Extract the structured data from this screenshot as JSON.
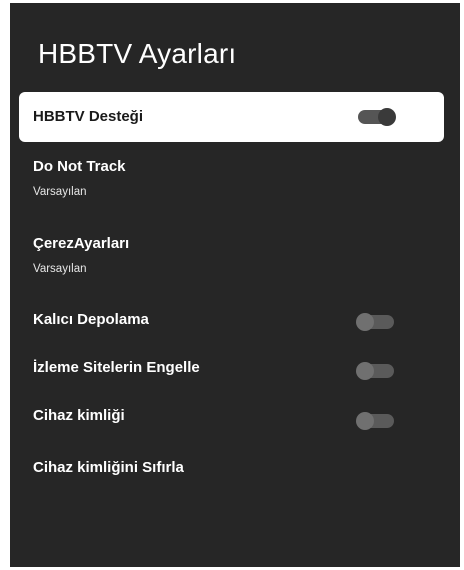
{
  "page": {
    "title": "HBBTV Ayarları"
  },
  "settings": [
    {
      "label": "HBBTV Desteği",
      "focused": true,
      "toggle": "on"
    },
    {
      "label": "Do Not Track",
      "sub": "Varsayılan"
    },
    {
      "label": "ÇerezAyarları",
      "sub": "Varsayılan"
    },
    {
      "label": "Kalıcı Depolama",
      "toggle": "off"
    },
    {
      "label": "İzleme Sitelerin Engelle",
      "toggle": "off"
    },
    {
      "label": "Cihaz kimliği",
      "toggle": "off"
    },
    {
      "label": "Cihaz kimliğini Sıfırla"
    }
  ],
  "colors": {
    "background": "#262626",
    "focus": "#ffffff"
  }
}
